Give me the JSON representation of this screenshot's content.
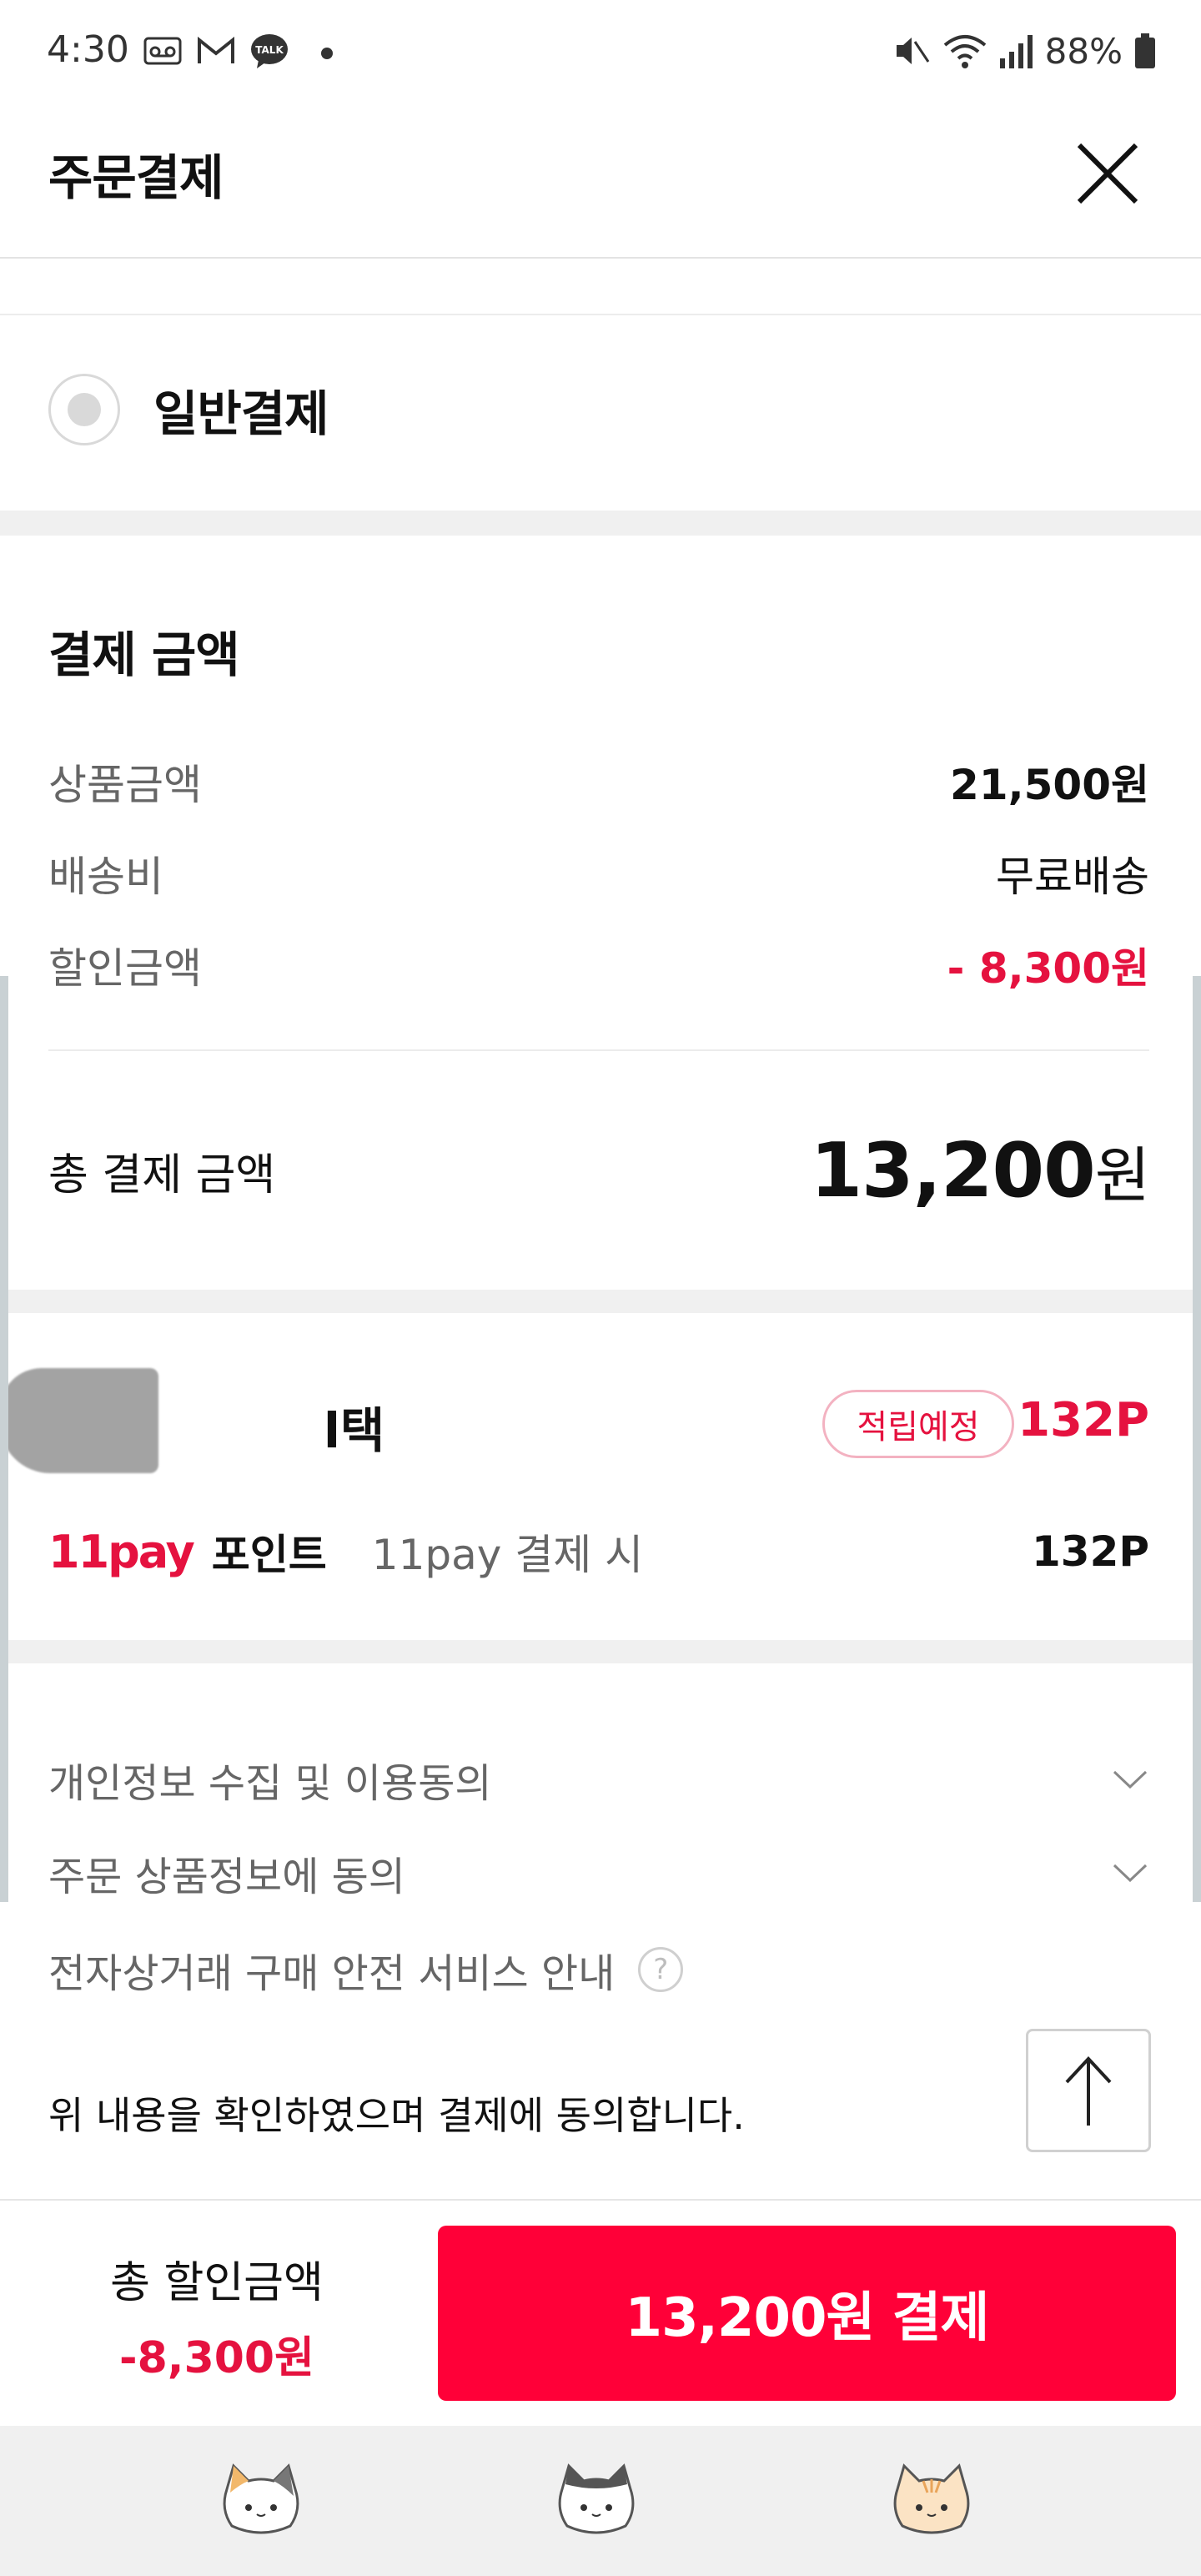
{
  "status_bar": {
    "time": "4:30",
    "battery": "88%",
    "icons": [
      "voicemail-icon",
      "gmail-icon",
      "kakaotalk-icon",
      "notification-dot-icon",
      "mute-icon",
      "wifi-icon",
      "signal-icon",
      "battery-icon"
    ]
  },
  "header": {
    "title": "주문결제",
    "close_icon": "close-icon"
  },
  "payment_method": {
    "label": "일반결제"
  },
  "amount": {
    "title": "결제 금액",
    "product_label": "상품금액",
    "product_value": "21,500원",
    "shipping_label": "배송비",
    "shipping_value": "무료배송",
    "discount_label": "할인금액",
    "discount_value": "- 8,300원",
    "total_label": "총 결제 금액",
    "total_number": "13,200",
    "total_unit": "원"
  },
  "benefit": {
    "title_partial": "l택",
    "badge": "적립예정",
    "points": "132P",
    "pay_logo": "11pay",
    "pay_label": "포인트",
    "pay_note": "11pay 결제 시",
    "pay_points": "132P"
  },
  "agreements": {
    "privacy": "개인정보 수집 및 이용동의",
    "product_info": "주문 상품정보에 동의",
    "safety": "전자상거래 구매 안전 서비스 안내",
    "help_glyph": "?",
    "confirm": "위 내용을 확인하였으며 결제에 동의합니다."
  },
  "bottom_bar": {
    "discount_label": "총 할인금액",
    "discount_value": "-8,300원",
    "pay_button": "13,200원 결제"
  },
  "colors": {
    "accent": "#ff0038",
    "accent_text": "#e5123f",
    "gray_band": "#f0f0f0"
  },
  "nav": {
    "items": [
      "calico-cat-icon",
      "black-white-cat-icon",
      "orange-cat-icon"
    ]
  }
}
